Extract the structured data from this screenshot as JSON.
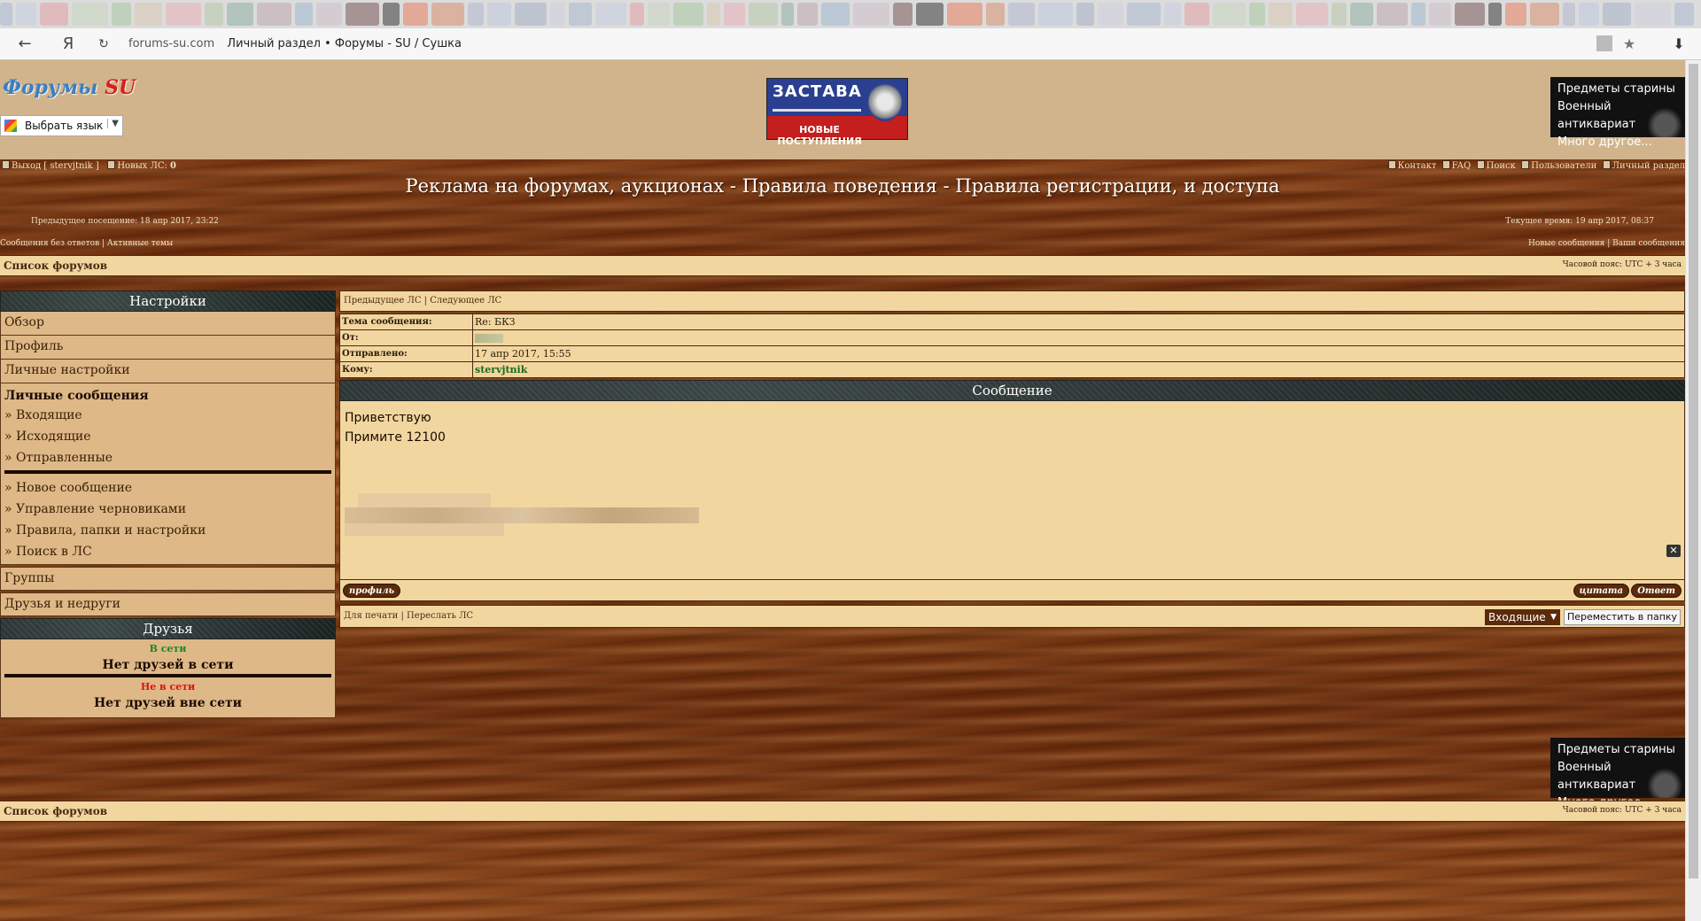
{
  "browser": {
    "url_domain": "forums-su.com",
    "url_title": "Личный раздел • Форумы - SU / Сушка",
    "back_icon": "←",
    "yandex_icon": "Я",
    "reload_icon": "↻",
    "star_icon": "★",
    "download_icon": "⬇"
  },
  "header": {
    "logo_part1": "Форумы",
    "logo_part2": "SU",
    "lang_select": "Выбрать язык",
    "zastava_title": "ЗАСТАВА",
    "zastava_sub": "НОВЫЕ ПОСТУПЛЕНИЯ",
    "antik_line1": "Предметы старины",
    "antik_line2": "Военный антиквариат",
    "antik_line3": "Много другое..."
  },
  "nav": {
    "logout": "Выход [ stervjtnik ]",
    "new_pm": "Новых ЛС:",
    "new_pm_count": "0",
    "contact": "Контакт",
    "faq": "FAQ",
    "search": "Поиск",
    "users": "Пользователи",
    "personal": "Личный раздел",
    "site_title": "Реклама на форумах, аукционах - Правила поведения - Правила регистрации, и доступа",
    "prev_visit": "Предыдущее посещение: 18 апр 2017, 23:22",
    "current_time": "Текущее время: 19 апр 2017, 08:37",
    "left_links": "Сообщения без ответов | Активные темы",
    "right_links": "Новые сообщения | Ваши сообщения",
    "forum_list": "Список форумов",
    "timezone": "Часовой пояс: UTC + 3 часа"
  },
  "sidebar": {
    "settings_title": "Настройки",
    "overview": "Обзор",
    "profile": "Профиль",
    "personal_settings": "Личные настройки",
    "pm_title": "Личные сообщения",
    "inbox": "» Входящие",
    "outbox": "» Исходящие",
    "sent": "» Отправленные",
    "new_msg": "» Новое сообщение",
    "drafts": "» Управление черновиками",
    "rules": "» Правила, папки и настройки",
    "pm_search": "» Поиск в ЛС",
    "groups": "Группы",
    "friends_foes": "Друзья и недруги",
    "friends_title": "Друзья",
    "online": "В сети",
    "no_online": "Нет друзей в сети",
    "offline": "Не в сети",
    "no_offline": "Нет друзей вне сети"
  },
  "message": {
    "nav": "Предыдущее ЛС | Следующее ЛС",
    "subject_label": "Тема сообщения:",
    "subject": "Re: БКЗ",
    "from_label": "От:",
    "sent_label": "Отправлено:",
    "sent_value": "17 апр 2017, 15:55",
    "to_label": "Кому:",
    "to_value": "stervjtnik",
    "section_title": "Сообщение",
    "line1": "Приветствую",
    "line2": "Примите 12100",
    "profile_btn": "профиль",
    "quote_btn": "цитата",
    "reply_btn": "Ответ",
    "print_links": "Для печати | Переслать ЛС",
    "folder": "Входящие",
    "move_btn": "Переместить в папку"
  },
  "colors": {
    "bar_bg": "#f2d6a0",
    "side_bg": "#deb887",
    "header_bg": "#d2b48c",
    "online": "#1a8a1a",
    "offline": "#e01010"
  }
}
